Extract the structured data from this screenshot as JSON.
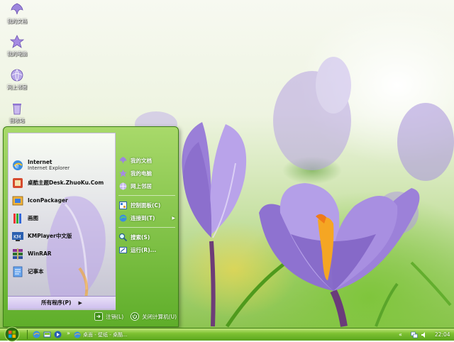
{
  "desktop": {
    "icons": [
      {
        "label": "我的文档",
        "icon": "my-documents-icon"
      },
      {
        "label": "我的电脑",
        "icon": "my-computer-icon"
      },
      {
        "label": "网上邻居",
        "icon": "network-places-icon"
      },
      {
        "label": "回收站",
        "icon": "recycle-bin-icon"
      }
    ]
  },
  "start_menu": {
    "programs": [
      {
        "name": "Internet",
        "sub": "Internet Explorer",
        "icon": "internet-explorer-icon"
      },
      {
        "name": "桌酷主题Desk.ZhuoKu.Com",
        "sub": "",
        "icon": "zhuoku-theme-icon"
      },
      {
        "name": "IconPackager",
        "sub": "",
        "icon": "iconpackager-icon"
      },
      {
        "name": "画图",
        "sub": "",
        "icon": "paint-icon"
      },
      {
        "name": "KMPlayer中文版",
        "sub": "",
        "icon": "kmplayer-icon"
      },
      {
        "name": "WinRAR",
        "sub": "",
        "icon": "winrar-icon"
      },
      {
        "name": "记事本",
        "sub": "",
        "icon": "notepad-icon"
      }
    ],
    "all_programs": "所有程序(P)",
    "right_items": [
      {
        "label": "我的文档",
        "icon": "my-documents-icon",
        "submenu": false
      },
      {
        "label": "我的电脑",
        "icon": "my-computer-icon",
        "submenu": false
      },
      {
        "label": "网上邻居",
        "icon": "network-places-icon",
        "submenu": false
      },
      {
        "label": "控制面板(C)",
        "icon": "control-panel-icon",
        "submenu": false
      },
      {
        "label": "连接到(T)",
        "icon": "connect-to-icon",
        "submenu": true
      },
      {
        "label": "搜索(S)",
        "icon": "search-icon",
        "submenu": false
      },
      {
        "label": "运行(R)...",
        "icon": "run-icon",
        "submenu": false
      }
    ],
    "footer": {
      "logoff": "注销(L)",
      "shutdown": "关闭计算机(U)"
    }
  },
  "taskbar": {
    "task": "桌面 - 壁纸 - 桌酷...",
    "clock": "22:04"
  },
  "colors": {
    "taskbar_green": "#7ec232",
    "menu_green": "#5fae2a",
    "crocus_purple": "#9b7fd6",
    "stamen_orange": "#f5a623"
  }
}
